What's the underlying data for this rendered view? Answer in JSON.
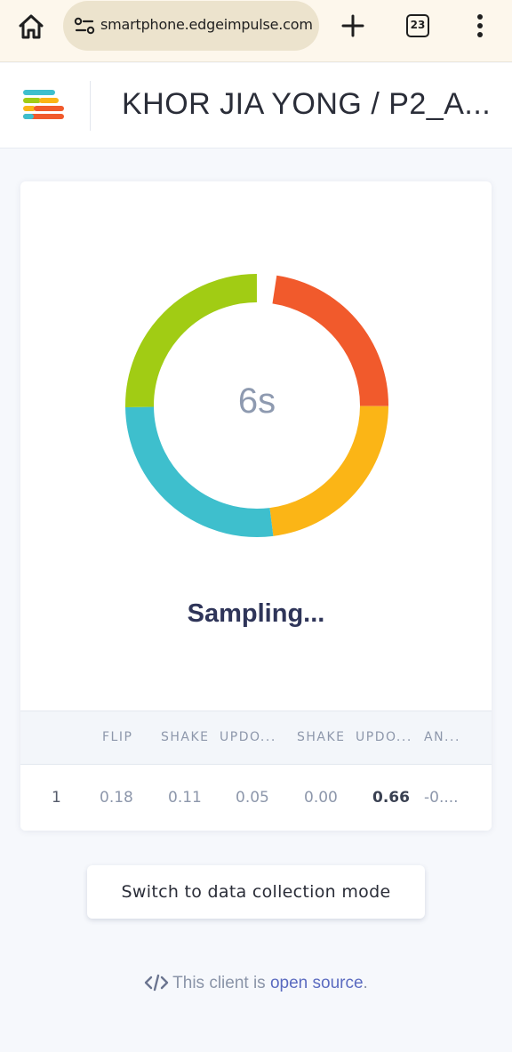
{
  "browser": {
    "url": "smartphone.edgeimpulse.com",
    "tab_count": "23",
    "icons": {
      "home": "home-icon",
      "site_info": "site-settings-icon",
      "new_tab": "plus-icon",
      "tabs": "tab-switcher-icon",
      "menu": "more-vert-icon"
    }
  },
  "header": {
    "logo": "edge-impulse-logo",
    "project_title": "KHOR JIA YONG / P2_A..."
  },
  "classifier": {
    "timer": "6s",
    "status": "Sampling...",
    "ring_colors": [
      "#f15a2c",
      "#fbb516",
      "#3ebfcd",
      "#a1cc14"
    ],
    "table": {
      "headers": [
        "",
        "FLIP",
        "SHAKE",
        "UPDO...",
        "SHAKE",
        "UPDO...",
        "AN..."
      ],
      "row": [
        "1",
        "0.18",
        "0.11",
        "0.05",
        "0.00",
        "0.66",
        "-0...."
      ],
      "highlight_index": 5
    }
  },
  "actions": {
    "switch_label": "Switch to data collection mode"
  },
  "footer": {
    "prefix": "This client is ",
    "link": "open source",
    "suffix": "."
  }
}
